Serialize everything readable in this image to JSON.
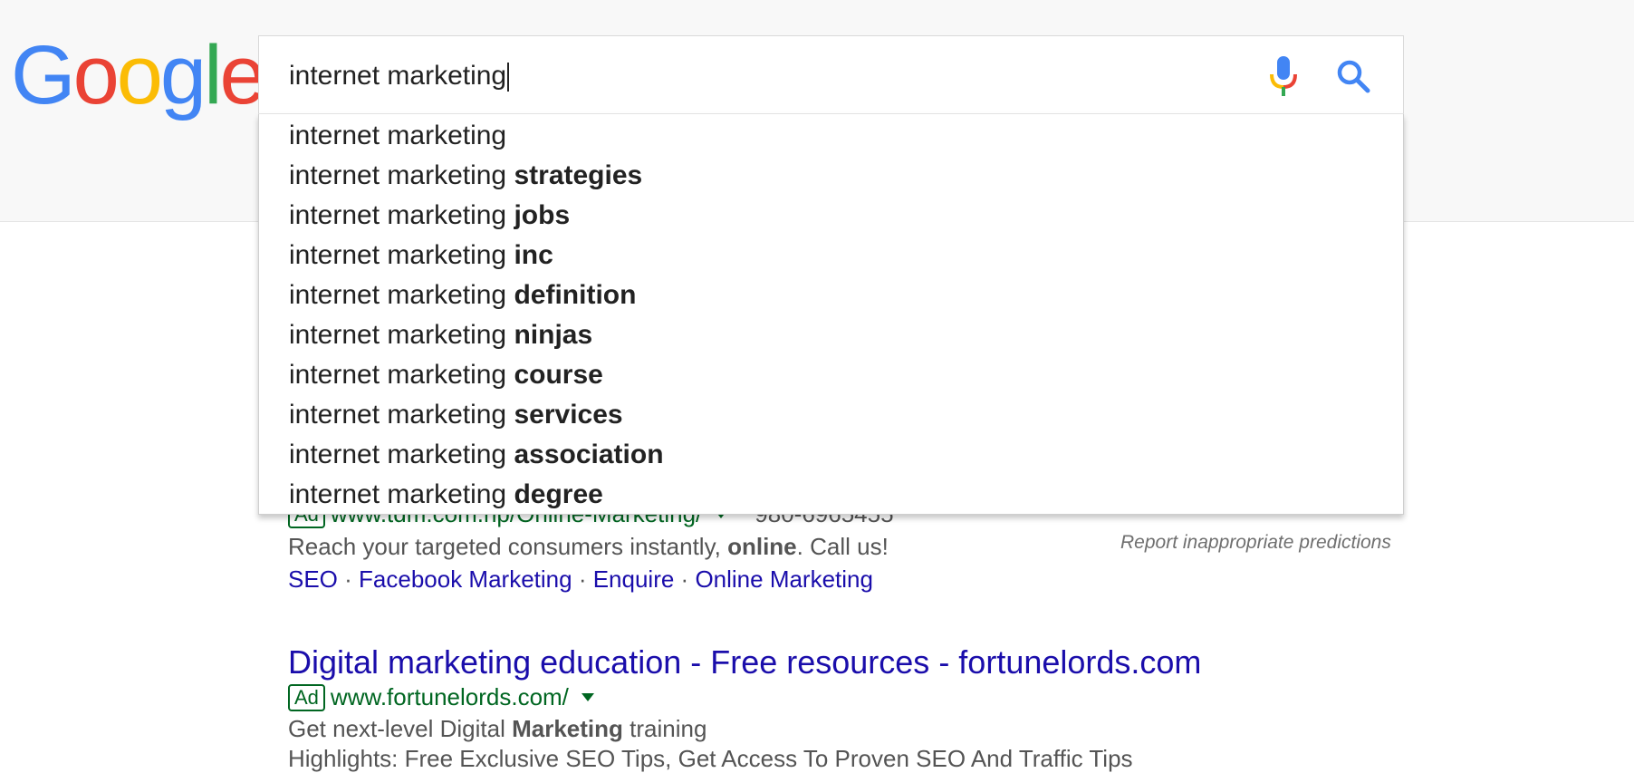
{
  "logo": {
    "letters": [
      "G",
      "o",
      "o",
      "g",
      "l",
      "e"
    ],
    "colors": [
      "#4285F4",
      "#EA4335",
      "#FBBC05",
      "#4285F4",
      "#34A853",
      "#EA4335"
    ]
  },
  "search": {
    "query": "internet marketing",
    "mic_icon": "microphone-icon",
    "search_icon": "magnifier-icon"
  },
  "suggestions": [
    {
      "prefix": "internet marketing",
      "suffix": ""
    },
    {
      "prefix": "internet marketing",
      "suffix": "strategies"
    },
    {
      "prefix": "internet marketing",
      "suffix": "jobs"
    },
    {
      "prefix": "internet marketing",
      "suffix": "inc"
    },
    {
      "prefix": "internet marketing",
      "suffix": "definition"
    },
    {
      "prefix": "internet marketing",
      "suffix": "ninjas"
    },
    {
      "prefix": "internet marketing",
      "suffix": "course"
    },
    {
      "prefix": "internet marketing",
      "suffix": "services"
    },
    {
      "prefix": "internet marketing",
      "suffix": "association"
    },
    {
      "prefix": "internet marketing",
      "suffix": "degree"
    }
  ],
  "report_link": "Report inappropriate predictions",
  "ad1": {
    "badge": "Ad",
    "url": "www.tdm.com.np/Online-Marketing/",
    "phone": "980-6965455",
    "desc_start": "Reach your targeted consumers instantly, ",
    "desc_bold": "online",
    "desc_end": ". Call us!",
    "sitelinks": [
      "SEO",
      "Facebook Marketing",
      "Enquire",
      "Online Marketing"
    ],
    "separator": " · "
  },
  "ad2": {
    "title": "Digital marketing education - Free resources - fortunelords.com",
    "badge": "Ad",
    "url": "www.fortunelords.com/",
    "desc_start": "Get next-level Digital ",
    "desc_bold": "Marketing",
    "desc_end": " training",
    "desc2": "Highlights: Free Exclusive SEO Tips, Get Access To Proven SEO And Traffic Tips"
  },
  "colors": {
    "link": "#1a0dab",
    "url_green": "#006621",
    "snippet": "#545454"
  }
}
